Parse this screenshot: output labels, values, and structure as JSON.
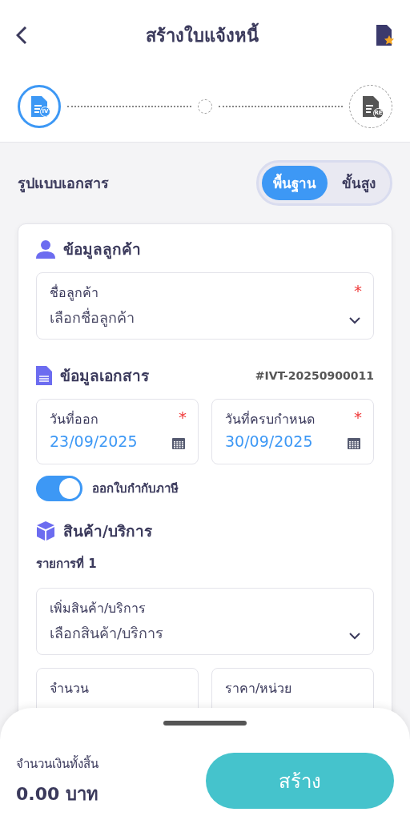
{
  "header": {
    "title": "สร้างใบแจ้งหนี้"
  },
  "steps": [
    {
      "kind": "document",
      "badge": "IV",
      "active": true
    },
    {
      "kind": "dot",
      "active": false
    },
    {
      "kind": "document",
      "badge": "RE",
      "active": false
    }
  ],
  "doc_format": {
    "label": "รูปแบบเอกสาร",
    "options": [
      {
        "label": "พื้นฐาน",
        "selected": true
      },
      {
        "label": "ขั้นสูง",
        "selected": false
      }
    ]
  },
  "customer": {
    "heading": "ข้อมูลลูกค้า",
    "field": {
      "label": "ชื่อลูกค้า",
      "required_mark": "*",
      "placeholder": "เลือกชื่อลูกค้า"
    }
  },
  "document": {
    "heading": "ข้อมูลเอกสาร",
    "number": "#IVT-20250900011",
    "dates": [
      {
        "label": "วันที่ออก",
        "required_mark": "*",
        "value": "23/09/2025"
      },
      {
        "label": "วันที่ครบกำหนด",
        "required_mark": "*",
        "value": "30/09/2025"
      }
    ],
    "tax_invoice": {
      "label": "ออกใบกำกับภาษี",
      "on": true
    }
  },
  "items": {
    "heading": "สินค้า/บริการ",
    "item_title": "รายการที่ 1",
    "product": {
      "label": "เพิ่มสินค้า/บริการ",
      "placeholder": "เลือกสินค้า/บริการ"
    },
    "fields": [
      {
        "label": "จำนวน"
      },
      {
        "label": "ราคา/หน่วย"
      }
    ]
  },
  "footer": {
    "total_label": "จำนวนเงินทั้งสิ้น",
    "total": "0.00 บาท",
    "button": "สร้าง"
  }
}
